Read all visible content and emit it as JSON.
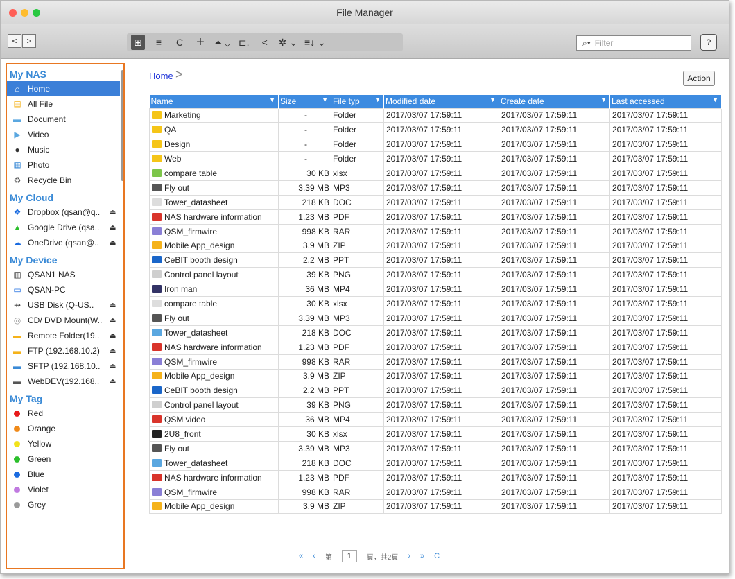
{
  "window": {
    "title": "File Manager"
  },
  "toolbar": {
    "nav_back": "<",
    "nav_forward": ">",
    "grid_view": "⊞",
    "list_view": "≡",
    "refresh": "C",
    "add": "+",
    "upload": "⏶ ⌄",
    "tree": "⊏.",
    "share": "<",
    "settings": "✲ ⌄",
    "sort": "≡↓ ⌄",
    "filter_placeholder": "Filter",
    "help": "?"
  },
  "sidebar": {
    "sections": [
      {
        "title": "My NAS",
        "items": [
          {
            "label": "Home",
            "icon": "home-icon",
            "selected": true
          },
          {
            "label": "All File",
            "icon": "all-file-icon"
          },
          {
            "label": "Document",
            "icon": "document-icon"
          },
          {
            "label": "Video",
            "icon": "video-icon"
          },
          {
            "label": "Music",
            "icon": "music-icon"
          },
          {
            "label": "Photo",
            "icon": "photo-icon"
          },
          {
            "label": "Recycle Bin",
            "icon": "recycle-bin-icon"
          }
        ]
      },
      {
        "title": "My Cloud",
        "items": [
          {
            "label": "Dropbox (qsan@q..",
            "icon": "dropbox-icon",
            "eject": true
          },
          {
            "label": "Google Drive (qsa..",
            "icon": "google-drive-icon",
            "eject": true
          },
          {
            "label": "OneDrive (qsan@..",
            "icon": "onedrive-icon",
            "eject": true
          }
        ]
      },
      {
        "title": "My Device",
        "items": [
          {
            "label": "QSAN1 NAS",
            "icon": "nas-icon"
          },
          {
            "label": "QSAN-PC",
            "icon": "pc-icon"
          },
          {
            "label": "USB Disk (Q-US..",
            "icon": "usb-icon",
            "eject": true
          },
          {
            "label": "CD/ DVD Mount(W..",
            "icon": "cd-icon",
            "eject": true
          },
          {
            "label": "Remote Folder(19..",
            "icon": "remote-folder-icon",
            "eject": true
          },
          {
            "label": "FTP (192.168.10.2)",
            "icon": "ftp-icon",
            "eject": true
          },
          {
            "label": "SFTP (192.168.10..",
            "icon": "sftp-icon",
            "eject": true
          },
          {
            "label": "WebDEV(192.168..",
            "icon": "webdav-icon",
            "eject": true
          }
        ]
      },
      {
        "title": "My Tag",
        "items": [
          {
            "label": "Red",
            "color": "#e81a1a"
          },
          {
            "label": "Orange",
            "color": "#f08a1a"
          },
          {
            "label": "Yellow",
            "color": "#f2e21a"
          },
          {
            "label": "Green",
            "color": "#2cbf2c"
          },
          {
            "label": "Blue",
            "color": "#1a6be0"
          },
          {
            "label": "Violet",
            "color": "#c07ae0"
          },
          {
            "label": "Grey",
            "color": "#9a9a9a"
          }
        ]
      }
    ]
  },
  "main": {
    "breadcrumb": "Home",
    "breadcrumb_sep": ">",
    "action_label": "Action",
    "columns": [
      "Name",
      "Size",
      "File typ",
      "Modified date",
      "Create date",
      "Last accessed"
    ],
    "rows": [
      [
        "Marketing",
        "-",
        "Folder",
        "2017/03/07 17:59:11",
        "2017/03/07 17:59:11",
        "2017/03/07 17:59:11",
        "folder"
      ],
      [
        "QA",
        "-",
        "Folder",
        "2017/03/07 17:59:11",
        "2017/03/07 17:59:11",
        "2017/03/07 17:59:11",
        "folder"
      ],
      [
        "Design",
        "-",
        "Folder",
        "2017/03/07 17:59:11",
        "2017/03/07 17:59:11",
        "2017/03/07 17:59:11",
        "folder"
      ],
      [
        "Web",
        "-",
        "Folder",
        "2017/03/07 17:59:11",
        "2017/03/07 17:59:11",
        "2017/03/07 17:59:11",
        "folder"
      ],
      [
        "compare table",
        "30 KB",
        "xlsx",
        "2017/03/07 17:59:11",
        "2017/03/07 17:59:11",
        "2017/03/07 17:59:11",
        "xlsx"
      ],
      [
        "Fly out",
        "3.39 MB",
        "MP3",
        "2017/03/07 17:59:11",
        "2017/03/07 17:59:11",
        "2017/03/07 17:59:11",
        "mp3"
      ],
      [
        "Tower_datasheet",
        "218 KB",
        "DOC",
        "2017/03/07 17:59:11",
        "2017/03/07 17:59:11",
        "2017/03/07 17:59:11",
        "doc"
      ],
      [
        "NAS hardware information",
        "1.23 MB",
        "PDF",
        "2017/03/07 17:59:11",
        "2017/03/07 17:59:11",
        "2017/03/07 17:59:11",
        "pdf"
      ],
      [
        "QSM_firmwire",
        "998 KB",
        "RAR",
        "2017/03/07 17:59:11",
        "2017/03/07 17:59:11",
        "2017/03/07 17:59:11",
        "rar"
      ],
      [
        "Mobile App_design",
        "3.9 MB",
        "ZIP",
        "2017/03/07 17:59:11",
        "2017/03/07 17:59:11",
        "2017/03/07 17:59:11",
        "zip"
      ],
      [
        "CeBIT booth design",
        "2.2 MB",
        "PPT",
        "2017/03/07 17:59:11",
        "2017/03/07 17:59:11",
        "2017/03/07 17:59:11",
        "ppt"
      ],
      [
        "Control panel layout",
        "39  KB",
        "PNG",
        "2017/03/07 17:59:11",
        "2017/03/07 17:59:11",
        "2017/03/07 17:59:11",
        "png"
      ],
      [
        "Iron man",
        "36 MB",
        "MP4",
        "2017/03/07 17:59:11",
        "2017/03/07 17:59:11",
        "2017/03/07 17:59:11",
        "mp4"
      ],
      [
        "compare table",
        "30 KB",
        "xlsx",
        "2017/03/07 17:59:11",
        "2017/03/07 17:59:11",
        "2017/03/07 17:59:11",
        "doc"
      ],
      [
        "Fly out",
        "3.39 MB",
        "MP3",
        "2017/03/07 17:59:11",
        "2017/03/07 17:59:11",
        "2017/03/07 17:59:11",
        "mp3"
      ],
      [
        "Tower_datasheet",
        "218 KB",
        "DOC",
        "2017/03/07 17:59:11",
        "2017/03/07 17:59:11",
        "2017/03/07 17:59:11",
        "docb"
      ],
      [
        "NAS hardware information",
        "1.23 MB",
        "PDF",
        "2017/03/07 17:59:11",
        "2017/03/07 17:59:11",
        "2017/03/07 17:59:11",
        "pdf"
      ],
      [
        "QSM_firmwire",
        "998 KB",
        "RAR",
        "2017/03/07 17:59:11",
        "2017/03/07 17:59:11",
        "2017/03/07 17:59:11",
        "rar"
      ],
      [
        "Mobile App_design",
        "3.9 MB",
        "ZIP",
        "2017/03/07 17:59:11",
        "2017/03/07 17:59:11",
        "2017/03/07 17:59:11",
        "zip"
      ],
      [
        "CeBIT booth design",
        "2.2 MB",
        "PPT",
        "2017/03/07 17:59:11",
        "2017/03/07 17:59:11",
        "2017/03/07 17:59:11",
        "ppt"
      ],
      [
        "Control panel layout",
        "39  KB",
        "PNG",
        "2017/03/07 17:59:11",
        "2017/03/07 17:59:11",
        "2017/03/07 17:59:11",
        "png"
      ],
      [
        "QSM video",
        "36 MB",
        "MP4",
        "2017/03/07 17:59:11",
        "2017/03/07 17:59:11",
        "2017/03/07 17:59:11",
        "video"
      ],
      [
        "2U8_front",
        "30 KB",
        "xlsx",
        "2017/03/07 17:59:11",
        "2017/03/07 17:59:11",
        "2017/03/07 17:59:11",
        "dark"
      ],
      [
        "Fly out",
        "3.39 MB",
        "MP3",
        "2017/03/07 17:59:11",
        "2017/03/07 17:59:11",
        "2017/03/07 17:59:11",
        "mp3"
      ],
      [
        "Tower_datasheet",
        "218 KB",
        "DOC",
        "2017/03/07 17:59:11",
        "2017/03/07 17:59:11",
        "2017/03/07 17:59:11",
        "docb"
      ],
      [
        "NAS hardware information",
        "1.23 MB",
        "PDF",
        "2017/03/07 17:59:11",
        "2017/03/07 17:59:11",
        "2017/03/07 17:59:11",
        "pdf"
      ],
      [
        "QSM_firmwire",
        "998 KB",
        "RAR",
        "2017/03/07 17:59:11",
        "2017/03/07 17:59:11",
        "2017/03/07 17:59:11",
        "rar"
      ],
      [
        "Mobile App_design",
        "3.9 MB",
        "ZIP",
        "2017/03/07 17:59:11",
        "2017/03/07 17:59:11",
        "2017/03/07 17:59:11",
        "zip"
      ]
    ]
  },
  "pager": {
    "first": "«",
    "prev": "‹",
    "label_page": "第",
    "page": "1",
    "label_total": "頁，共2頁",
    "next": "›",
    "last": "»",
    "refresh": "C"
  },
  "colors": {
    "accent": "#3d8be0",
    "sidebar_border": "#e87722",
    "section_title": "#3a8ad6",
    "selected": "#3b7fd8"
  },
  "file_icon_colors": {
    "folder": "#f5c518",
    "xlsx": "#7dc64a",
    "mp3": "#555555",
    "doc": "#dddddd",
    "docb": "#5aa7e0",
    "pdf": "#d9342b",
    "rar": "#8a7fd6",
    "zip": "#f5b21a",
    "ppt": "#1a66c9",
    "png": "#cfcfcf",
    "mp4": "#333366",
    "video": "#d9342b",
    "dark": "#222222"
  }
}
